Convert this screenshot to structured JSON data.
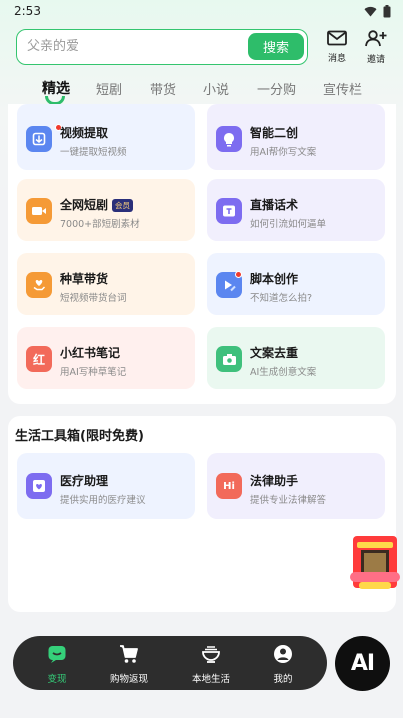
{
  "status_bar": {
    "time": "2:53"
  },
  "search": {
    "placeholder": "父亲的爱",
    "button_label": "搜索"
  },
  "header_actions": {
    "messages_label": "消息",
    "invite_label": "邀请"
  },
  "tabs": [
    {
      "label": "精选",
      "active": true
    },
    {
      "label": "短剧"
    },
    {
      "label": "带货"
    },
    {
      "label": "小说"
    },
    {
      "label": "一分购"
    },
    {
      "label": "宣传栏"
    }
  ],
  "tools": [
    {
      "title": "视频提取",
      "subtitle": "一键提取短视频",
      "icon": "video-extract-icon",
      "color": "#5b86f0",
      "bg": "#eef3ff",
      "badge_dot": true
    },
    {
      "title": "智能二创",
      "subtitle": "用AI帮你写文案",
      "icon": "lightbulb-icon",
      "color": "#7d6cf0",
      "bg": "#f1effd"
    },
    {
      "title": "全网短剧",
      "badge": "会员",
      "subtitle": "7000+部短剧素材",
      "icon": "video-camera-icon",
      "color": "#f59a36",
      "bg": "#fff4e8"
    },
    {
      "title": "直播话术",
      "subtitle": "如何引流如何逼单",
      "icon": "live-script-icon",
      "color": "#7d6cf0",
      "bg": "#f1effd"
    },
    {
      "title": "种草带货",
      "subtitle": "短视频带货台词",
      "icon": "heart-hand-icon",
      "color": "#f59a36",
      "bg": "#fff4e8"
    },
    {
      "title": "脚本创作",
      "subtitle": "不知道怎么拍?",
      "icon": "script-video-icon",
      "color": "#5b86f0",
      "bg": "#eef3ff",
      "badge_dot": true
    },
    {
      "title": "小红书笔记",
      "subtitle": "用AI写种草笔记",
      "icon": "xiaohongshu-icon",
      "icon_text": "红",
      "color": "#f26a5a",
      "bg": "#fff0ee"
    },
    {
      "title": "文案去重",
      "subtitle": "AI生成创意文案",
      "icon": "camera-icon",
      "color": "#3fc07c",
      "bg": "#eaf8f0"
    }
  ],
  "life_section": {
    "title": "生活工具箱(限时免费)",
    "items": [
      {
        "title": "医疗助理",
        "subtitle": "提供实用的医疗建议",
        "icon": "medical-heart-icon",
        "color": "#7d6cf0",
        "bg": "#f1effd"
      },
      {
        "title": "法律助手",
        "subtitle": "提供专业法律解答",
        "icon": "legal-chat-icon",
        "icon_text": "Hi",
        "color": "#f26a5a",
        "bg": "#fff0ee"
      }
    ]
  },
  "bottom_nav": [
    {
      "label": "变现",
      "icon": "monetize-icon",
      "active": true
    },
    {
      "label": "购物返现",
      "icon": "cart-icon"
    },
    {
      "label": "本地生活",
      "icon": "food-bowl-icon"
    },
    {
      "label": "我的",
      "icon": "user-icon"
    }
  ],
  "ai_button": {
    "label": "AI"
  },
  "colors": {
    "accent": "#2ebd6a",
    "nav_bg": "#2d2d2d",
    "active_nav": "#35d07a"
  }
}
